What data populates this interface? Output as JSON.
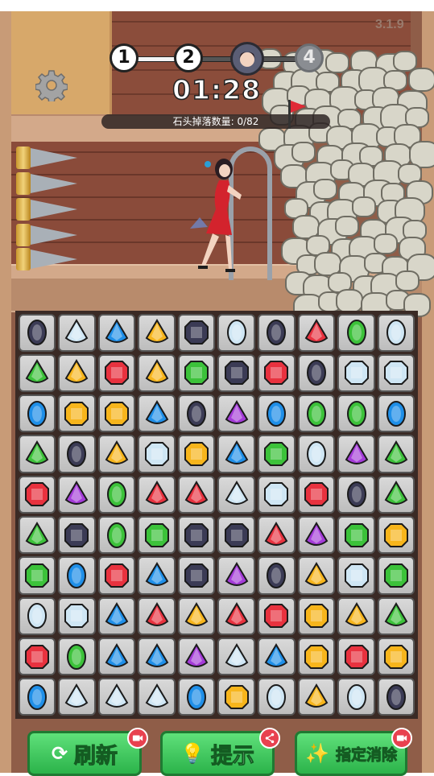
{
  "version": "3.1.9",
  "progress": {
    "nodes": [
      {
        "label": "1",
        "state": "done"
      },
      {
        "label": "2",
        "state": "current"
      },
      {
        "label": "boss",
        "state": "boss"
      },
      {
        "label": "4",
        "state": "locked"
      }
    ]
  },
  "timer": "01:28",
  "stone_counter": {
    "label": "石头掉落数量:",
    "value": "0/82"
  },
  "settings_icon": "gear-icon",
  "board": {
    "rows": [
      [
        "dark-oval",
        "clear-drop",
        "blue-drop",
        "yellow-drop",
        "dark-oct",
        "clear-oval",
        "dark-oval",
        "red-drop",
        "green-oval",
        "clear-oval"
      ],
      [
        "green-drop",
        "yellow-drop",
        "red-oct",
        "yellow-drop",
        "green-oct",
        "dark-oct",
        "red-oct",
        "dark-oval",
        "clear-oct",
        "clear-oct"
      ],
      [
        "blue-oval",
        "yellow-oct",
        "yellow-oct",
        "blue-drop",
        "dark-oval",
        "purple-drop",
        "blue-oval",
        "green-oval",
        "green-oval",
        "blue-oval"
      ],
      [
        "green-drop",
        "dark-oval",
        "yellow-drop",
        "clear-oct",
        "yellow-oct",
        "blue-drop",
        "green-oct",
        "clear-oval",
        "purple-drop",
        "green-drop"
      ],
      [
        "red-oct",
        "purple-drop",
        "green-oval",
        "red-drop",
        "red-drop",
        "clear-drop",
        "clear-oct",
        "red-oct",
        "dark-oval",
        "green-drop"
      ],
      [
        "green-drop",
        "dark-oct",
        "green-oval",
        "green-oct",
        "dark-oct",
        "dark-oct",
        "red-drop",
        "purple-drop",
        "green-oct",
        "yellow-oct"
      ],
      [
        "green-oct",
        "blue-oval",
        "red-oct",
        "blue-drop",
        "dark-oct",
        "purple-drop",
        "dark-oval",
        "yellow-drop",
        "clear-oct",
        "green-oct"
      ],
      [
        "clear-oval",
        "clear-oct",
        "blue-drop",
        "red-drop",
        "yellow-drop",
        "red-drop",
        "red-oct",
        "yellow-oct",
        "yellow-drop",
        "green-drop"
      ],
      [
        "red-oct",
        "green-oval",
        "blue-drop",
        "blue-drop",
        "purple-drop",
        "clear-drop",
        "blue-drop",
        "yellow-oct",
        "red-oct",
        "yellow-oct"
      ],
      [
        "blue-oval",
        "clear-drop",
        "clear-drop",
        "clear-drop",
        "blue-oval",
        "yellow-oct",
        "clear-oval",
        "yellow-drop",
        "clear-oval",
        "dark-oval"
      ]
    ]
  },
  "gem_colors": {
    "red": "#e8323f",
    "yellow": "#f7b51c",
    "green": "#3cc23a",
    "blue": "#1f8fe8",
    "purple": "#a43bd8",
    "clear": "#cfe6f4",
    "dark": "#3b3b55"
  },
  "buttons": {
    "refresh": {
      "label": "刷新",
      "icon": "refresh-icon",
      "badge": "video-icon"
    },
    "hint": {
      "label": "提示",
      "icon": "lightbulb-icon",
      "badge": "share-icon"
    },
    "remove": {
      "label": "指定消除",
      "icon": "magic-wand-icon",
      "badge": "video-icon"
    }
  }
}
